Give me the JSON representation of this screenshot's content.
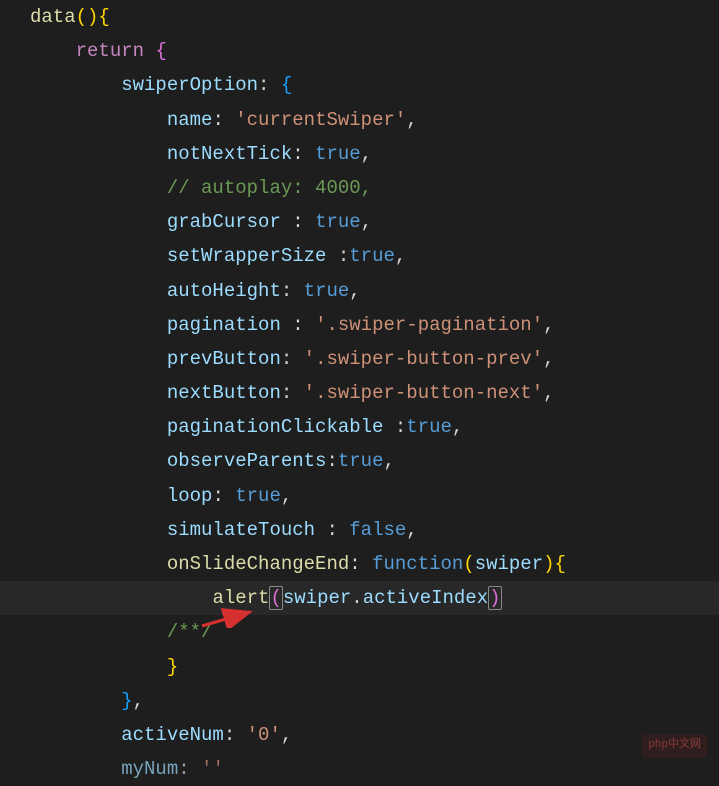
{
  "code": {
    "line1_data": "data",
    "line2_return": "return",
    "line3_swiperOption": "swiperOption",
    "line4_name": "name",
    "line4_val": "'currentSwiper'",
    "line5_notNextTick": "notNextTick",
    "line5_val": "true",
    "line6_comment": "// autoplay: 4000,",
    "line7_grabCursor": "grabCursor",
    "line7_val": "true",
    "line8_setWrapperSize": "setWrapperSize",
    "line8_val": "true",
    "line9_autoHeight": "autoHeight",
    "line9_val": "true",
    "line10_pagination": "pagination",
    "line10_val": "'.swiper-pagination'",
    "line11_prevButton": "prevButton",
    "line11_val": "'.swiper-button-prev'",
    "line12_nextButton": "nextButton",
    "line12_val": "'.swiper-button-next'",
    "line13_paginationClickable": "paginationClickable",
    "line13_val": "true",
    "line14_observeParents": "observeParents",
    "line14_val": "true",
    "line15_loop": "loop",
    "line15_val": "true",
    "line16_simulateTouch": "simulateTouch",
    "line16_val": "false",
    "line17_onSlideChangeEnd": "onSlideChangeEnd",
    "line17_function": "function",
    "line17_param": "swiper",
    "line18_alert": "alert",
    "line18_swiper": "swiper",
    "line18_activeIndex": "activeIndex",
    "line19_comment": "/**/",
    "line22_activeNum": "activeNum",
    "line22_val": "'0'",
    "line23_myNum": "myNum",
    "line23_val": "''"
  },
  "watermark": "php中文网"
}
